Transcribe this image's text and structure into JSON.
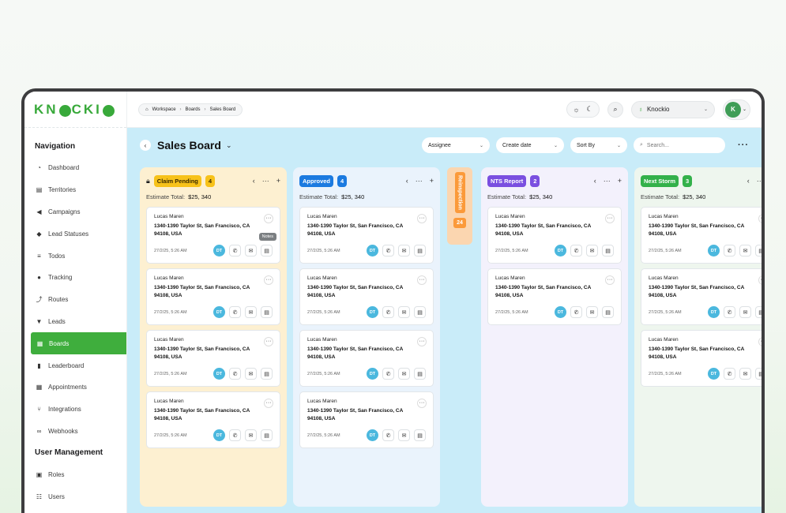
{
  "brand": {
    "name": "KN CKI"
  },
  "sidebar": {
    "nav_heading": "Navigation",
    "items": [
      {
        "label": "Dashboard",
        "icon": "dashboard-icon",
        "glyph": "◔"
      },
      {
        "label": "Territories",
        "icon": "map-icon",
        "glyph": "▤"
      },
      {
        "label": "Campaigns",
        "icon": "megaphone-icon",
        "glyph": "◀"
      },
      {
        "label": "Lead Statuses",
        "icon": "tag-icon",
        "glyph": "◆"
      },
      {
        "label": "Todos",
        "icon": "list-icon",
        "glyph": "≡"
      },
      {
        "label": "Tracking",
        "icon": "location-pin-icon",
        "glyph": "●"
      },
      {
        "label": "Routes",
        "icon": "route-icon",
        "glyph": "⤴"
      },
      {
        "label": "Leads",
        "icon": "funnel-icon",
        "glyph": "▼"
      },
      {
        "label": "Boards",
        "icon": "board-icon",
        "glyph": "▦"
      },
      {
        "label": "Leaderboard",
        "icon": "bar-chart-icon",
        "glyph": "▮"
      },
      {
        "label": "Appointments",
        "icon": "calendar-icon",
        "glyph": "▦"
      },
      {
        "label": "Integrations",
        "icon": "branch-icon",
        "glyph": "⑂"
      },
      {
        "label": "Webhooks",
        "icon": "webhook-icon",
        "glyph": "∞"
      }
    ],
    "user_heading": "User Management",
    "user_items": [
      {
        "label": "Roles",
        "icon": "id-card-icon",
        "glyph": "▣"
      },
      {
        "label": "Users",
        "icon": "users-icon",
        "glyph": "☷"
      }
    ]
  },
  "topbar": {
    "breadcrumb": [
      "Workspace",
      "Boards",
      "Sales Board"
    ],
    "org_name": "Knockio",
    "avatar_initial": "K"
  },
  "board": {
    "title": "Sales Board",
    "filters": [
      "Assignee",
      "Create date",
      "Sort By"
    ],
    "search_placeholder": "Search..."
  },
  "card": {
    "name": "Lucas Maren",
    "address": "1340-1390 Taylor St, San Francisco, CA 94108, USA",
    "date": "27/2/25, 5:26 AM",
    "assignee": "DT",
    "tooltip": "Notes"
  },
  "columns": [
    {
      "name": "Claim Pending",
      "count": "4",
      "estimate_label": "Estimate Total:",
      "estimate": "$25, 340",
      "color": "#f7c21a",
      "bg": "#fdf0d1"
    },
    {
      "name": "Approved",
      "count": "4",
      "estimate_label": "Estimate Total:",
      "estimate": "$25, 340",
      "color": "#1b7ae0",
      "bg": "#eaf3fc"
    },
    {
      "name": "NTS Report",
      "count": "2",
      "estimate_label": "Estimate Total:",
      "estimate": "$25, 340",
      "color": "#7a4fe0",
      "bg": "#f3f1fc"
    },
    {
      "name": "Next Storm",
      "count": "3",
      "estimate_label": "Estimate Total:",
      "estimate": "$25, 340",
      "color": "#33b14a",
      "bg": "#eef6ee"
    }
  ],
  "collapsed_column": {
    "name": "Reinspection",
    "count": "24"
  }
}
